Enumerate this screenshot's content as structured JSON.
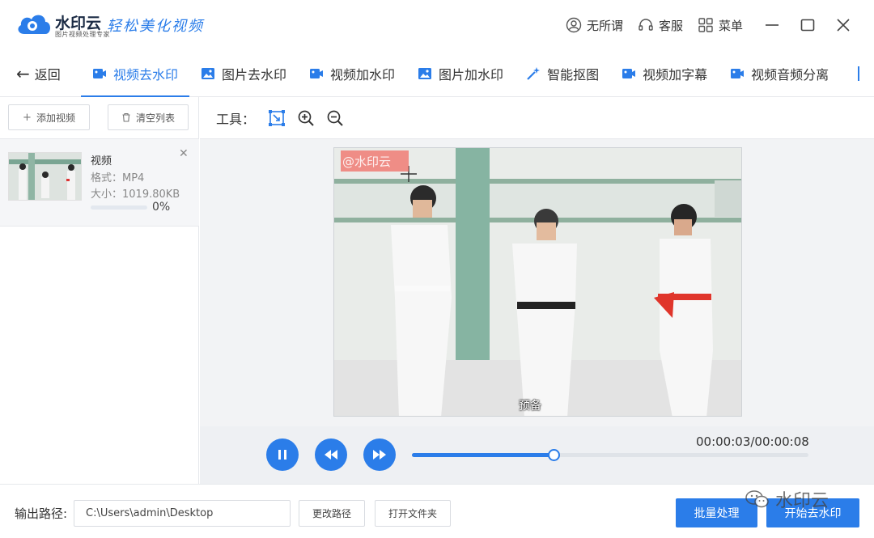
{
  "brand": {
    "name": "水印云",
    "subtitle": "图片视频处理专家",
    "slogan": "轻松美化视频"
  },
  "titlebar": {
    "user_label": "无所谓",
    "service_label": "客服",
    "menu_label": "菜单"
  },
  "tabs": {
    "back_label": "返回",
    "items": [
      {
        "label": "视频去水印",
        "icon": "video-icon",
        "active": true
      },
      {
        "label": "图片去水印",
        "icon": "image-icon"
      },
      {
        "label": "视频加水印",
        "icon": "video-icon"
      },
      {
        "label": "图片加水印",
        "icon": "image-icon"
      },
      {
        "label": "智能抠图",
        "icon": "magic-wand-icon"
      },
      {
        "label": "视频加字幕",
        "icon": "video-icon"
      },
      {
        "label": "视频音频分离",
        "icon": "video-icon"
      }
    ]
  },
  "left_panel": {
    "add_video_label": "添加视频",
    "clear_list_label": "清空列表",
    "file": {
      "name": "视频",
      "format": "格式：MP4",
      "size": "大小：1019.80KB",
      "progress": 0,
      "progress_text": "0%"
    }
  },
  "toolbar": {
    "label": "工具："
  },
  "video": {
    "watermark_text": "@水印云",
    "subtitle": "预备"
  },
  "player": {
    "time": "00:00:03/00:00:08",
    "progress_fraction": 0.36
  },
  "bottom": {
    "output_label": "输出路径:",
    "output_path": "C:\\Users\\admin\\Desktop",
    "change_path_label": "更改路径",
    "open_folder_label": "打开文件夹",
    "batch_label": "批量处理",
    "start_label": "开始去水印",
    "wechat_mark": "水印云"
  },
  "colors": {
    "accent": "#2b7de9",
    "watermark_box": "#f06e64"
  }
}
